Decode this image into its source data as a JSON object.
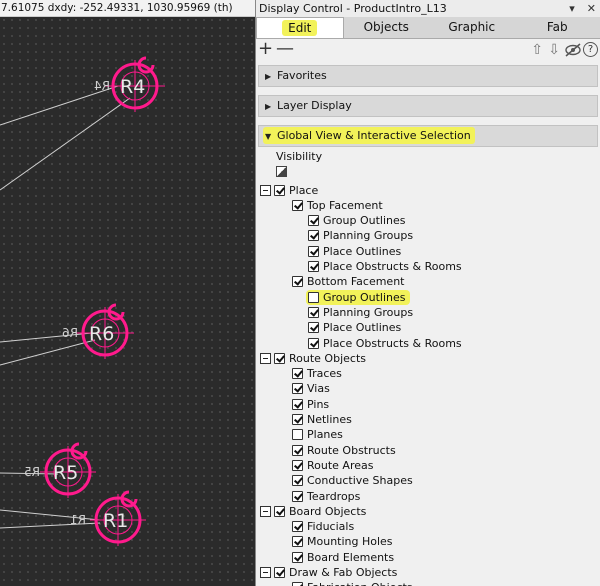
{
  "canvas": {
    "coord_text": "7.61075  dxdy: -252.49331, 1030.95969  (th)",
    "components": [
      {
        "name": "component-r4",
        "label": "R4",
        "mirror": "R4"
      },
      {
        "name": "component-r6",
        "label": "R6",
        "mirror": "R6"
      },
      {
        "name": "component-r5",
        "label": "R5",
        "mirror": "R5"
      },
      {
        "name": "component-r1",
        "label": "R1",
        "mirror": "R1"
      }
    ],
    "colors": {
      "background": "#2b2b2b",
      "component": "#ff1a8c",
      "net": "#cfcfcf"
    }
  },
  "panel": {
    "title": "Display Control - ProductIntro_L13",
    "title_buttons": [
      "▾",
      "✕"
    ],
    "tabs": [
      {
        "label": "Edit",
        "active": true
      },
      {
        "label": "Objects",
        "active": false
      },
      {
        "label": "Graphic",
        "active": false
      },
      {
        "label": "Fab",
        "active": false
      }
    ],
    "toolbar": {
      "add": "+",
      "remove": "—",
      "up": "⇧",
      "down": "⇩",
      "help": "?"
    },
    "sections": [
      {
        "label": "Favorites",
        "expanded": false
      },
      {
        "label": "Layer Display",
        "expanded": false
      },
      {
        "label": "Global View & Interactive Selection",
        "expanded": true
      }
    ],
    "visibility_label": "Visibility",
    "tree": [
      {
        "label": "Place",
        "checked": true
      },
      {
        "label": "Top Facement",
        "checked": true
      },
      {
        "label": "Group Outlines",
        "checked": true
      },
      {
        "label": "Planning Groups",
        "checked": true
      },
      {
        "label": "Place Outlines",
        "checked": true
      },
      {
        "label": "Place Obstructs & Rooms",
        "checked": true
      },
      {
        "label": "Bottom Facement",
        "checked": true
      },
      {
        "label": "Group Outlines",
        "checked": false
      },
      {
        "label": "Planning Groups",
        "checked": true
      },
      {
        "label": "Place Outlines",
        "checked": true
      },
      {
        "label": "Place Obstructs & Rooms",
        "checked": true
      },
      {
        "label": "Route Objects",
        "checked": true
      },
      {
        "label": "Traces",
        "checked": true
      },
      {
        "label": "Vias",
        "checked": true
      },
      {
        "label": "Pins",
        "checked": true
      },
      {
        "label": "Netlines",
        "checked": true
      },
      {
        "label": "Planes",
        "checked": false
      },
      {
        "label": "Route Obstructs",
        "checked": true
      },
      {
        "label": "Route Areas",
        "checked": true
      },
      {
        "label": "Conductive Shapes",
        "checked": true
      },
      {
        "label": "Teardrops",
        "checked": true
      },
      {
        "label": "Board Objects",
        "checked": true
      },
      {
        "label": "Fiducials",
        "checked": true
      },
      {
        "label": "Mounting Holes",
        "checked": true
      },
      {
        "label": "Board Elements",
        "checked": true
      },
      {
        "label": "Draw & Fab Objects",
        "checked": true
      },
      {
        "label": "Fabrication Objects",
        "checked": true
      }
    ],
    "highlight_color": "#f2f25a"
  }
}
